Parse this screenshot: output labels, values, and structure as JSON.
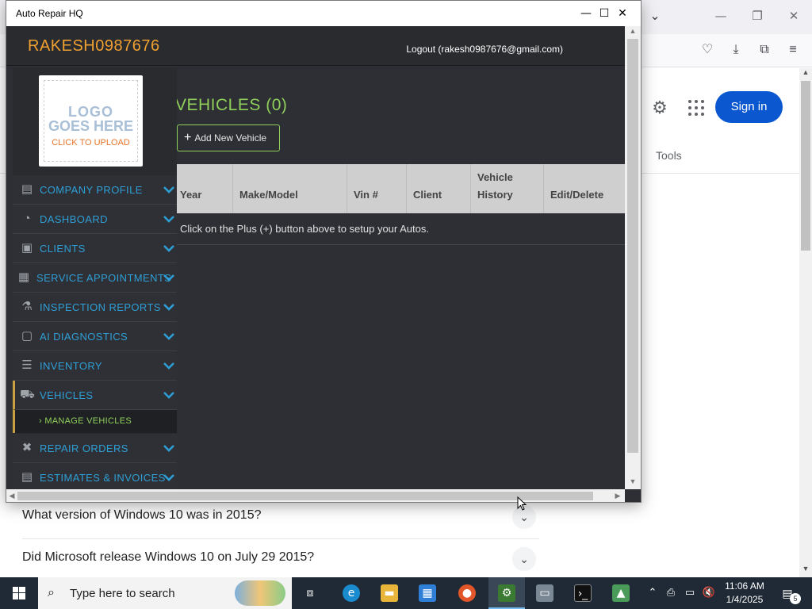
{
  "browser": {
    "sign_in_label": "Sign in",
    "tools_label": "Tools",
    "faq": [
      {
        "question": "What version of Windows 10 was in 2015?"
      },
      {
        "question": "Did Microsoft release Windows 10 on July 29 2015?"
      }
    ]
  },
  "window": {
    "title": "Auto Repair HQ",
    "minimize": "—",
    "maximize": "☐",
    "close": "✕"
  },
  "header": {
    "brand": "RAKESH0987676",
    "logout": "Logout (rakesh0987676@gmail.com)"
  },
  "logo": {
    "line1": "LOGO",
    "line2": "GOES HERE",
    "line3": "CLICK TO UPLOAD"
  },
  "sidebar": {
    "items": [
      {
        "label": "COMPANY PROFILE",
        "icon": "building-icon"
      },
      {
        "label": "DASHBOARD",
        "icon": "gauge-icon"
      },
      {
        "label": "CLIENTS",
        "icon": "contact-card-icon"
      },
      {
        "label": "SERVICE APPOINTMENTS",
        "icon": "calendar-icon"
      },
      {
        "label": "INSPECTION REPORTS",
        "icon": "microscope-icon"
      },
      {
        "label": "AI DIAGNOSTICS",
        "icon": "chip-icon"
      },
      {
        "label": "INVENTORY",
        "icon": "checklist-icon"
      },
      {
        "label": "VEHICLES",
        "icon": "car-icon"
      },
      {
        "label": "REPAIR ORDERS",
        "icon": "tools-icon"
      },
      {
        "label": "ESTIMATES & INVOICES",
        "icon": "invoice-icon"
      }
    ],
    "sub_item": "MANAGE VEHICLES"
  },
  "main": {
    "title": "VEHICLES (0)",
    "add_button": "Add New Vehicle",
    "columns": [
      "Year",
      "Make/Model",
      "Vin #",
      "Client",
      "Vehicle History",
      "Edit/Delete"
    ],
    "empty_message": "Click on the Plus (+) button above to setup your Autos."
  },
  "taskbar": {
    "search_placeholder": "Type here to search",
    "time": "11:06 AM",
    "date": "1/4/2025",
    "notification_count": "5"
  },
  "colors": {
    "brand": "#f0a030",
    "nav_label": "#2e9fd6",
    "accent_green": "#8fcf5a",
    "active_marker": "#c8a040",
    "signin_blue": "#0b57d0"
  }
}
